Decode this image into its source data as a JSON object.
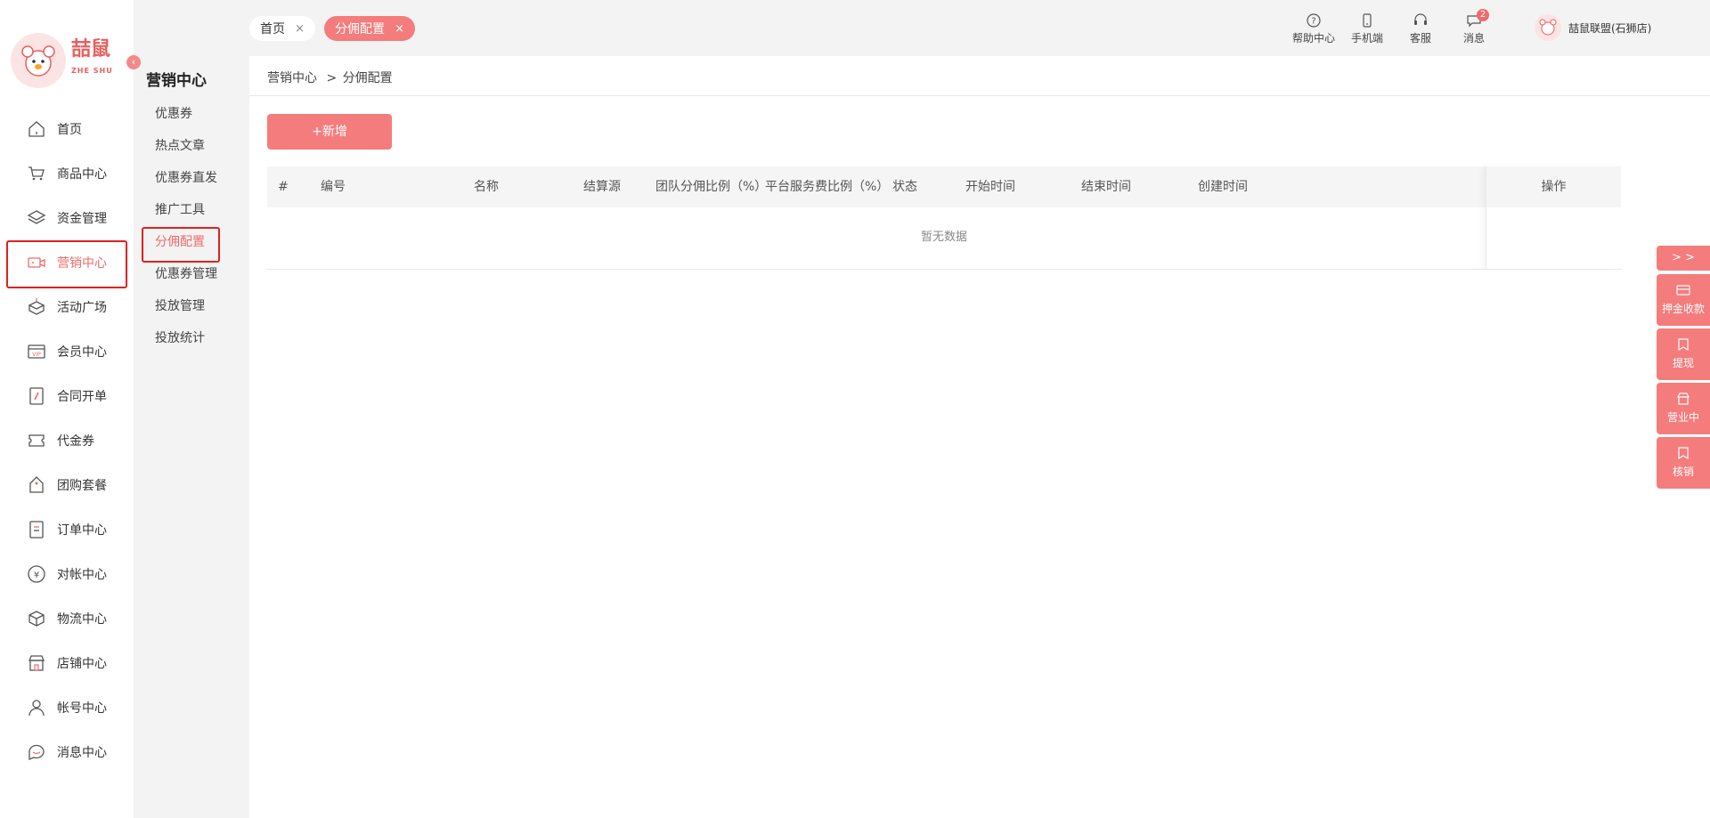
{
  "brand": {
    "name": "喆鼠",
    "sub": "ZHE SHU"
  },
  "collapse_icon": "chevron-left-icon",
  "sidebar": {
    "items": [
      {
        "label": "首页",
        "icon": "home-icon"
      },
      {
        "label": "商品中心",
        "icon": "cart-icon"
      },
      {
        "label": "资金管理",
        "icon": "layers-icon"
      },
      {
        "label": "营销中心",
        "icon": "camera-icon",
        "active": true
      },
      {
        "label": "活动广场",
        "icon": "box-icon"
      },
      {
        "label": "会员中心",
        "icon": "vip-card-icon"
      },
      {
        "label": "合同开单",
        "icon": "contract-icon"
      },
      {
        "label": "代金券",
        "icon": "voucher-icon"
      },
      {
        "label": "团购套餐",
        "icon": "tag-icon"
      },
      {
        "label": "订单中心",
        "icon": "order-icon"
      },
      {
        "label": "对帐中心",
        "icon": "yen-icon"
      },
      {
        "label": "物流中心",
        "icon": "package-icon"
      },
      {
        "label": "店铺中心",
        "icon": "shop-icon"
      },
      {
        "label": "帐号中心",
        "icon": "user-icon"
      },
      {
        "label": "消息中心",
        "icon": "chat-icon"
      }
    ]
  },
  "submenu": {
    "title": "营销中心",
    "items": [
      {
        "label": "优惠券"
      },
      {
        "label": "热点文章"
      },
      {
        "label": "优惠券直发"
      },
      {
        "label": "推广工具"
      },
      {
        "label": "分佣配置",
        "active": true
      },
      {
        "label": "优惠券管理"
      },
      {
        "label": "投放管理"
      },
      {
        "label": "投放统计"
      }
    ]
  },
  "tabs": [
    {
      "label": "首页",
      "close": "×"
    },
    {
      "label": "分佣配置",
      "close": "×"
    }
  ],
  "toolbar": {
    "help": "帮助中心",
    "mobile": "手机端",
    "service": "客服",
    "messages": "消息",
    "message_count": "2",
    "user": "喆鼠联盟(石狮店)"
  },
  "breadcrumb": {
    "parent": "营销中心",
    "sep": ">",
    "current": "分佣配置"
  },
  "add_button": "+新增",
  "table": {
    "columns": [
      "#",
      "编号",
      "名称",
      "结算源",
      "团队分佣比例（%）",
      "平台服务费比例（%）",
      "状态",
      "开始时间",
      "结束时间",
      "创建时间"
    ],
    "op_column": "操作",
    "empty_text": "暂无数据"
  },
  "float_panel": {
    "toggle": "> >",
    "items": [
      {
        "label": "押金收款",
        "icon": "card-icon"
      },
      {
        "label": "提现",
        "icon": "bookmark-icon"
      },
      {
        "label": "营业中",
        "icon": "store-icon"
      },
      {
        "label": "核销",
        "icon": "bookmark-icon"
      }
    ]
  },
  "colors": {
    "accent": "#f57c7c",
    "highlight_border": "#e02020"
  }
}
